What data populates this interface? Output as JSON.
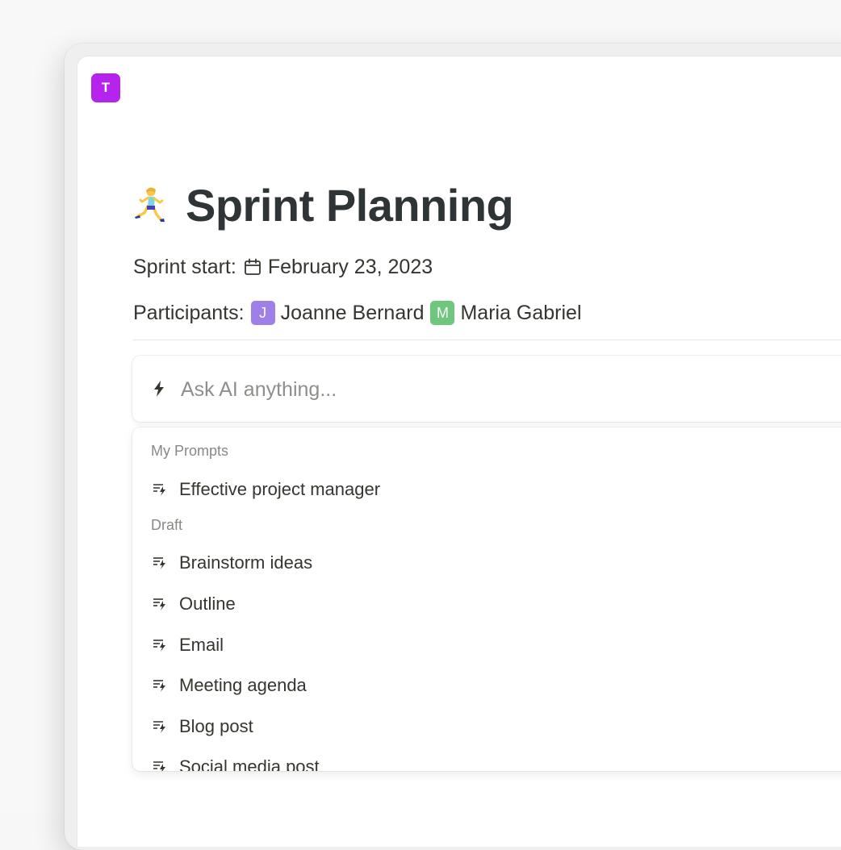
{
  "workspace": {
    "avatar_letter": "T",
    "avatar_color": "#b523ec"
  },
  "page": {
    "icon": "running-person-emoji-icon",
    "title": "Sprint Planning"
  },
  "properties": {
    "sprint_start": {
      "label": "Sprint start:",
      "icon": "calendar-icon",
      "value": "February 23, 2023"
    },
    "participants": {
      "label": "Participants:",
      "people": [
        {
          "initial": "J",
          "name": "Joanne Bernard",
          "color": "#9f80e8"
        },
        {
          "initial": "M",
          "name": "Maria Gabriel",
          "color": "#6fc67d"
        }
      ]
    }
  },
  "ai": {
    "icon": "lightning-bolt-icon",
    "placeholder": "Ask AI anything..."
  },
  "menu": {
    "sections": [
      {
        "title": "My Prompts",
        "items": [
          {
            "label": "Effective project manager",
            "icon": "prompt-icon"
          }
        ]
      },
      {
        "title": "Draft",
        "items": [
          {
            "label": "Brainstorm ideas",
            "icon": "prompt-icon"
          },
          {
            "label": "Outline",
            "icon": "prompt-icon"
          },
          {
            "label": "Email",
            "icon": "prompt-icon"
          },
          {
            "label": "Meeting agenda",
            "icon": "prompt-icon"
          },
          {
            "label": "Blog post",
            "icon": "prompt-icon"
          },
          {
            "label": "Social media post",
            "icon": "prompt-icon"
          }
        ]
      }
    ]
  }
}
